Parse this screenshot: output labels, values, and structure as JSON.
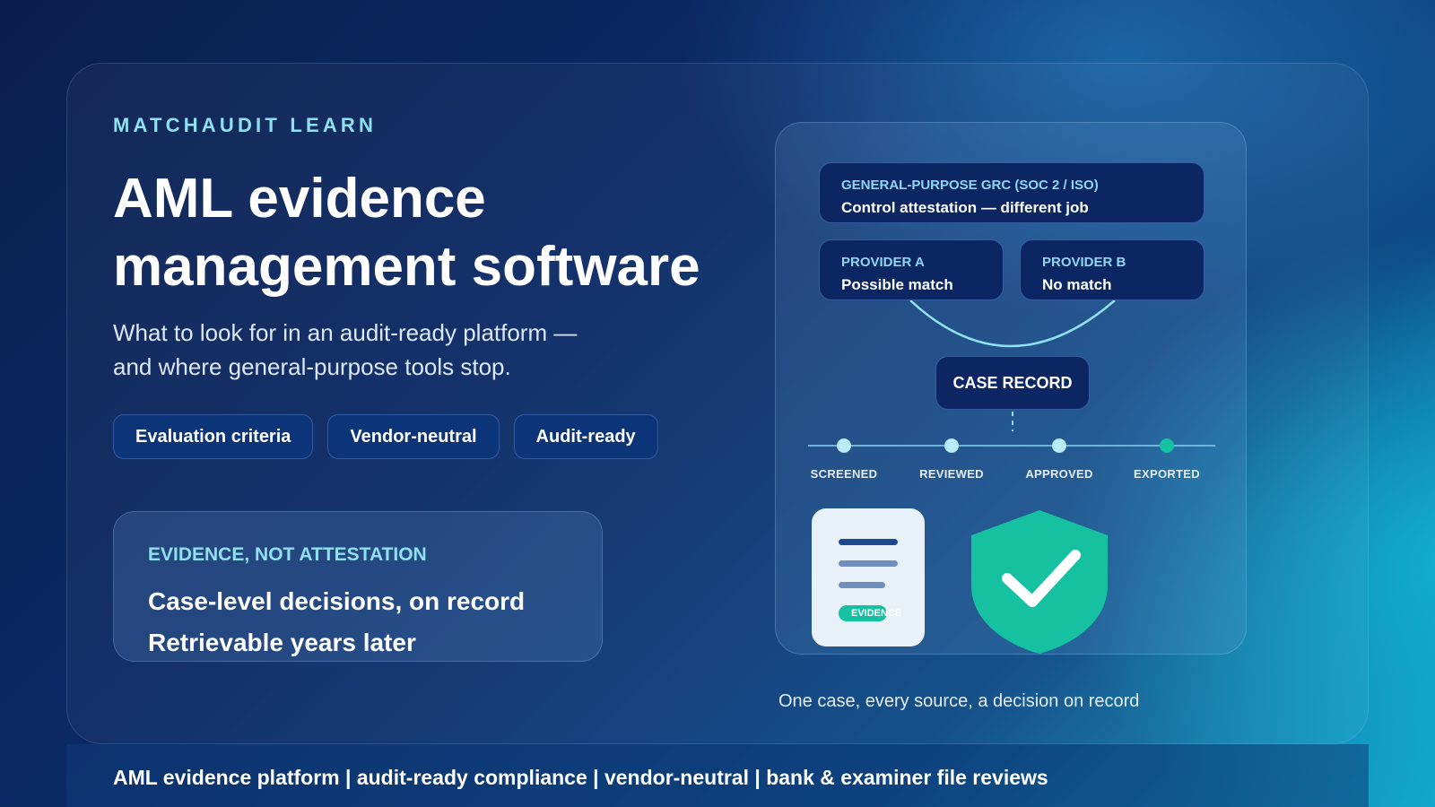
{
  "brand": {
    "eyebrow": "MATCHAUDIT LEARN"
  },
  "hero": {
    "title": "AML evidence management software",
    "subtitle": "What to look for in an audit-ready platform — and where general-purpose tools stop."
  },
  "pills": [
    "Evaluation criteria",
    "Vendor-neutral",
    "Audit-ready"
  ],
  "evidence_box": {
    "label": "EVIDENCE, NOT ATTESTATION",
    "line1": "Case-level decisions, on record",
    "line2": "Retrievable years later"
  },
  "diagram": {
    "grc": {
      "title": "GENERAL-PURPOSE GRC (SOC 2 / ISO)",
      "subtitle": "Control attestation — different job"
    },
    "provider_a": {
      "title": "PROVIDER A",
      "subtitle": "Possible match"
    },
    "provider_b": {
      "title": "PROVIDER B",
      "subtitle": "No match"
    },
    "case_record": "CASE RECORD",
    "stages": [
      "SCREENED",
      "REVIEWED",
      "APPROVED",
      "EXPORTED"
    ],
    "doc_tag": "EVIDENCE",
    "colors": {
      "accent": "#8fe0f0",
      "success": "#15c1a0",
      "node": "#0b2663"
    }
  },
  "caption": "One case, every source, a decision on record",
  "footer": "AML evidence platform | audit-ready compliance | vendor-neutral | bank & examiner file reviews"
}
